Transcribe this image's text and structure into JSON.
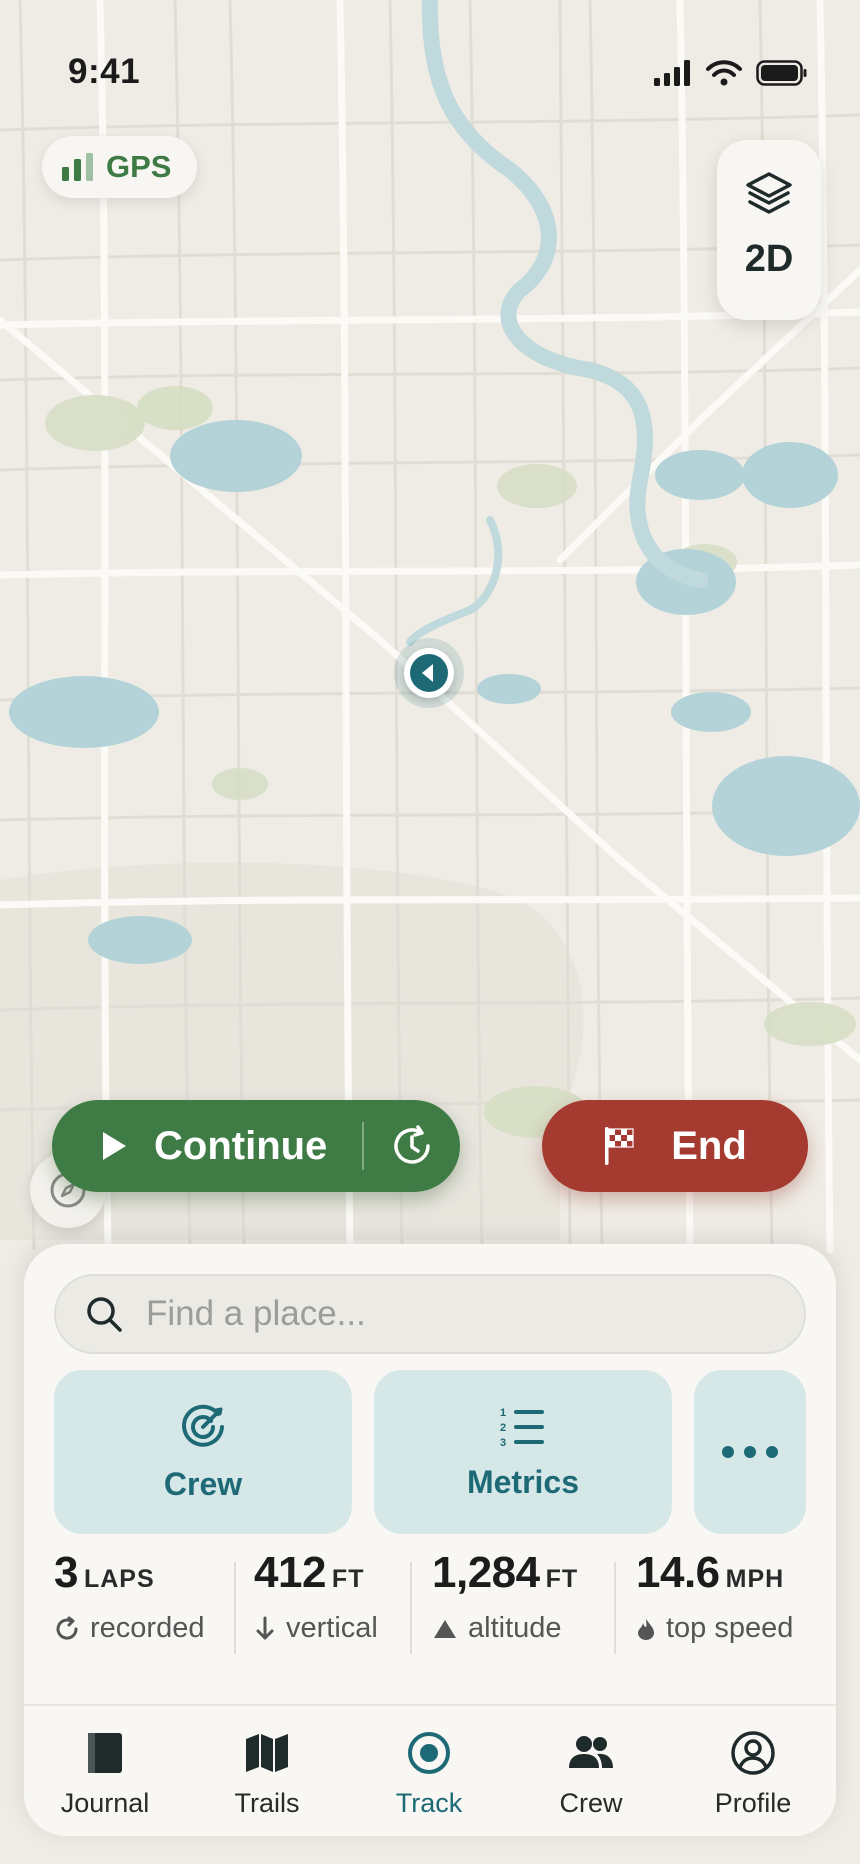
{
  "status_bar": {
    "time": "9:41"
  },
  "gps": {
    "label": "GPS"
  },
  "map_controls": {
    "mode": "2D"
  },
  "actions": {
    "continue_label": "Continue",
    "end_label": "End"
  },
  "search": {
    "placeholder": "Find a place..."
  },
  "quick_actions": [
    {
      "label": "Crew",
      "icon": "target-icon"
    },
    {
      "label": "Metrics",
      "icon": "numbered-list-icon"
    },
    {
      "label": "",
      "icon": "more-icon"
    }
  ],
  "stats": [
    {
      "value": "3",
      "unit": "LAPS",
      "sub": "recorded",
      "icon": "refresh-icon"
    },
    {
      "value": "412",
      "unit": "FT",
      "sub": "vertical",
      "icon": "arrow-down-icon"
    },
    {
      "value": "1,284",
      "unit": "FT",
      "sub": "altitude",
      "icon": "mountain-icon"
    },
    {
      "value": "14.6",
      "unit": "MPH",
      "sub": "top speed",
      "icon": "flame-icon"
    }
  ],
  "tabs": [
    {
      "label": "Journal",
      "icon": "journal-icon"
    },
    {
      "label": "Trails",
      "icon": "map-icon"
    },
    {
      "label": "Track",
      "icon": "track-icon",
      "active": true
    },
    {
      "label": "Crew",
      "icon": "people-icon"
    },
    {
      "label": "Profile",
      "icon": "profile-icon"
    }
  ],
  "colors": {
    "accent": "#1d6a76",
    "continue": "#3f7c45",
    "end": "#a53b30",
    "water": "#b3d3d8",
    "park": "#d6dec4"
  }
}
